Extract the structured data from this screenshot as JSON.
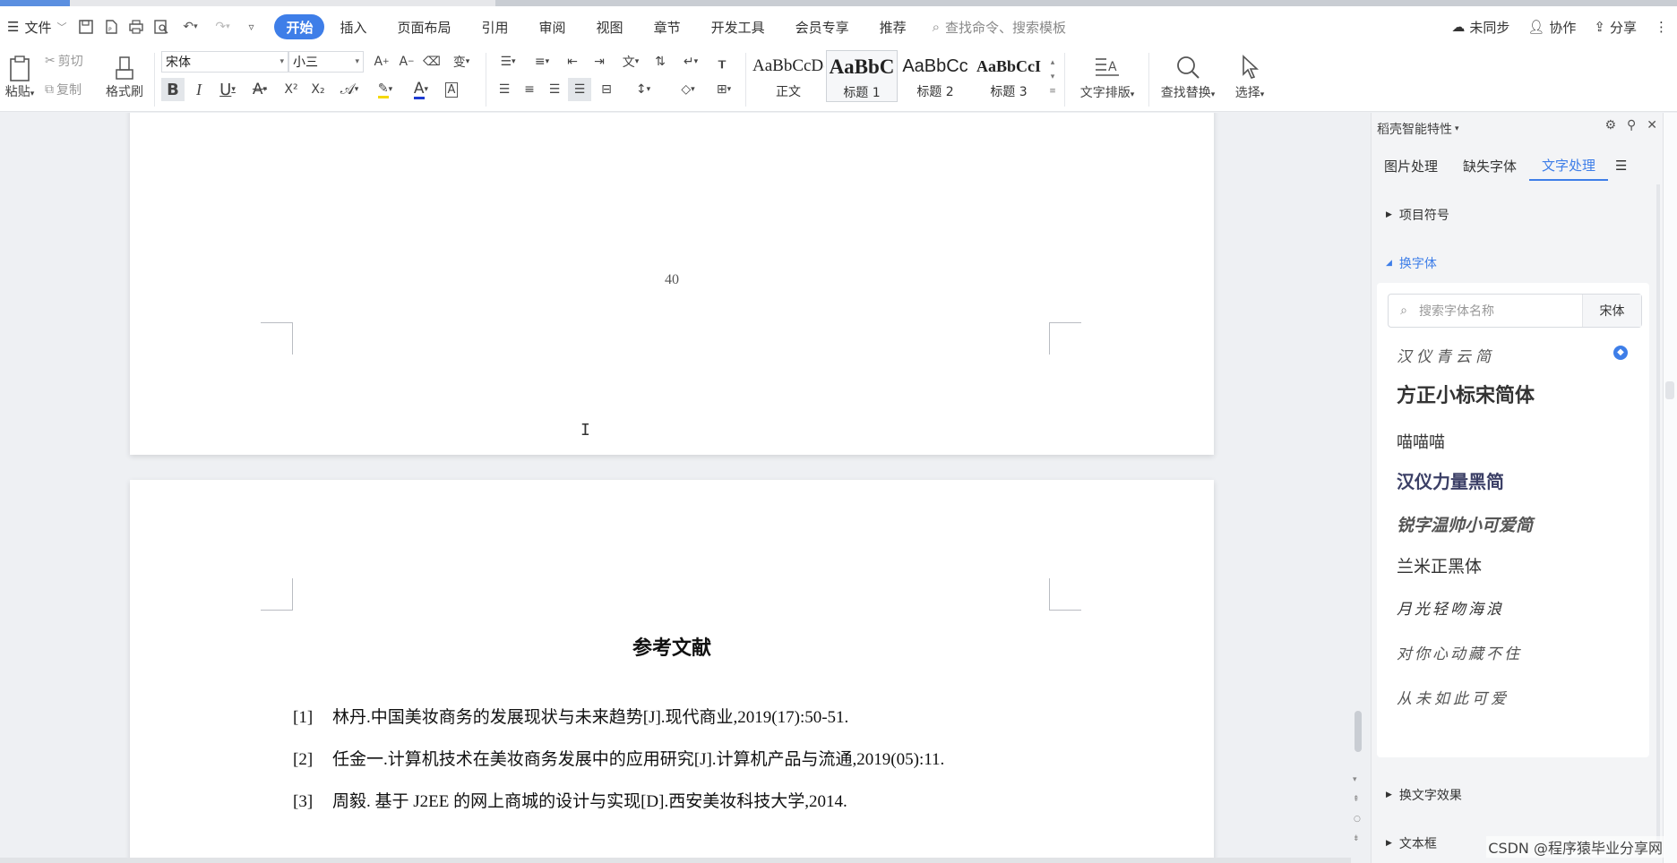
{
  "menubar": {
    "file": "文件",
    "tabs": [
      "开始",
      "插入",
      "页面布局",
      "引用",
      "审阅",
      "视图",
      "章节",
      "开发工具",
      "会员专享",
      "推荐"
    ],
    "search_placeholder": "查找命令、搜索模板",
    "right": {
      "sync": "未同步",
      "collab": "协作",
      "share": "分享"
    }
  },
  "ribbon": {
    "paste": "粘贴",
    "cut": "剪切",
    "copy": "复制",
    "format_painter": "格式刷",
    "font_name": "宋体",
    "font_size": "小三",
    "styles": [
      {
        "sample": "AaBbCcDd",
        "name": "正文"
      },
      {
        "sample": "AaBbC",
        "name": "标题 1"
      },
      {
        "sample": "AaBbCc",
        "name": "标题 2"
      },
      {
        "sample": "AaBbCcI",
        "name": "标题 3"
      }
    ],
    "text_layout": "文字排版",
    "find_replace": "查找替换",
    "select": "选择"
  },
  "document": {
    "page_number": "40",
    "heading": "参考文献",
    "references": [
      {
        "num": "[1]",
        "text": "林丹.中国美妆商务的发展现状与未来趋势[J].现代商业,2019(17):50-51."
      },
      {
        "num": "[2]",
        "text": "任金一.计算机技术在美妆商务发展中的应用研究[J].计算机产品与流通,2019(05):11."
      },
      {
        "num": "[3]",
        "text": "周毅. 基于 J2EE 的网上商城的设计与实现[D].西安美妆科技大学,2014."
      }
    ]
  },
  "panel": {
    "title": "稻壳智能特性",
    "tabs": [
      "图片处理",
      "缺失字体",
      "文字处理"
    ],
    "sections": {
      "bullets": "项目符号",
      "change_font": "换字体",
      "text_effect": "换文字效果",
      "textbox": "文本框"
    },
    "search": {
      "placeholder": "搜索字体名称",
      "current": "宋体"
    },
    "fonts": [
      "汉仪青云简",
      "方正小标宋简体",
      "喵喵喵",
      "汉仪力量黑简",
      "锐字温帅小可爱简",
      "兰米正黑体",
      "月光轻吻海浪",
      "对你心动藏不住",
      "从未如此可爱"
    ]
  },
  "watermark": "CSDN @程序猿毕业分享网",
  "colors": {
    "accent": "#3e7ee8",
    "canvas": "#eef0f3"
  }
}
